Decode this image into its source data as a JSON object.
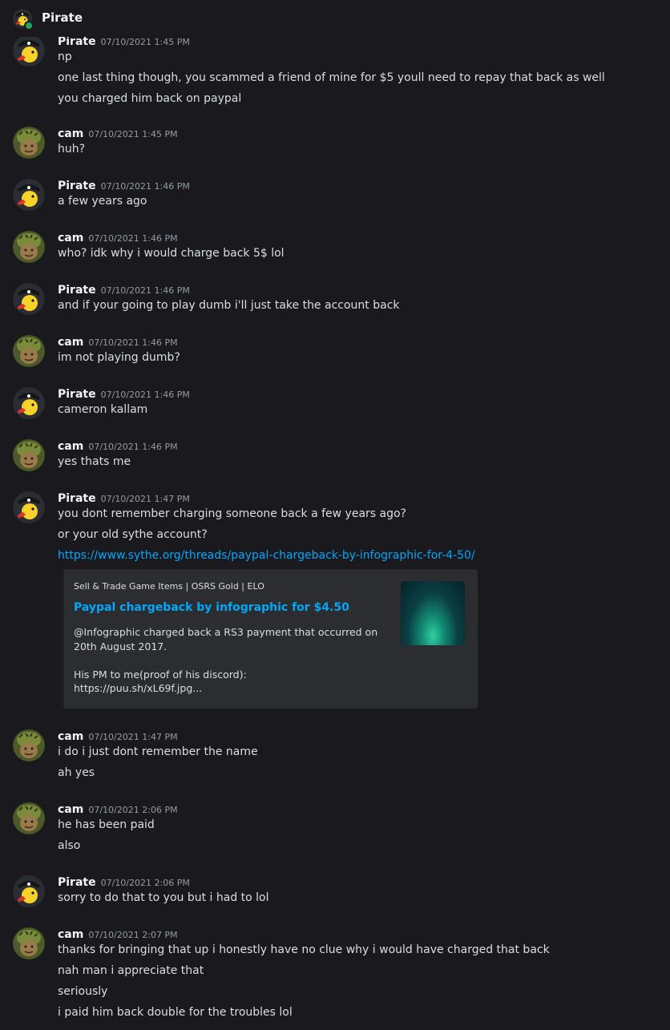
{
  "header": {
    "title": "Pirate"
  },
  "embed": {
    "provider": "Sell & Trade Game Items | OSRS Gold | ELO",
    "title": "Paypal chargeback by infographic for $4.50",
    "description": "@Infographic charged back a RS3 payment that occurred on 20th August 2017.\n\nHis PM to me(proof of his discord):\nhttps://puu.sh/xL69f.jpg..."
  },
  "messages": [
    {
      "author": "Pirate",
      "timestamp": "07/10/2021 1:45 PM",
      "lines": [
        "np",
        "one last thing though, you scammed a friend of mine for $5 youll need to repay that back as well",
        "you charged him back on paypal"
      ]
    },
    {
      "author": "cam",
      "timestamp": "07/10/2021 1:45 PM",
      "lines": [
        "huh?"
      ]
    },
    {
      "author": "Pirate",
      "timestamp": "07/10/2021 1:46 PM",
      "lines": [
        "a few years ago"
      ]
    },
    {
      "author": "cam",
      "timestamp": "07/10/2021 1:46 PM",
      "lines": [
        "who? idk why i would charge back 5$ lol"
      ]
    },
    {
      "author": "Pirate",
      "timestamp": "07/10/2021 1:46 PM",
      "lines": [
        "and if your going to play dumb i'll just take the account back"
      ]
    },
    {
      "author": "cam",
      "timestamp": "07/10/2021 1:46 PM",
      "lines": [
        "im not playing dumb?"
      ]
    },
    {
      "author": "Pirate",
      "timestamp": "07/10/2021 1:46 PM",
      "lines": [
        "cameron kallam"
      ]
    },
    {
      "author": "cam",
      "timestamp": "07/10/2021 1:46 PM",
      "lines": [
        "yes thats me"
      ]
    },
    {
      "author": "Pirate",
      "timestamp": "07/10/2021 1:47 PM",
      "lines": [
        "you dont remember charging someone back a few years ago?",
        "or your old sythe account?",
        "https://www.sythe.org/threads/paypal-chargeback-by-infographic-for-4-50/"
      ]
    },
    {
      "author": "cam",
      "timestamp": "07/10/2021 1:47 PM",
      "lines": [
        "i do i just dont remember the name",
        "ah yes"
      ]
    },
    {
      "author": "cam",
      "timestamp": "07/10/2021 2:06 PM",
      "lines": [
        "he has been paid",
        "also"
      ]
    },
    {
      "author": "Pirate",
      "timestamp": "07/10/2021 2:06 PM",
      "lines": [
        "sorry to do that to you but i had to lol"
      ]
    },
    {
      "author": "cam",
      "timestamp": "07/10/2021 2:07 PM",
      "lines": [
        "thanks for bringing that up i honestly have no clue why i would have charged that back",
        "nah man i appreciate that",
        "seriously",
        "i paid him back double for the troubles lol"
      ]
    }
  ]
}
